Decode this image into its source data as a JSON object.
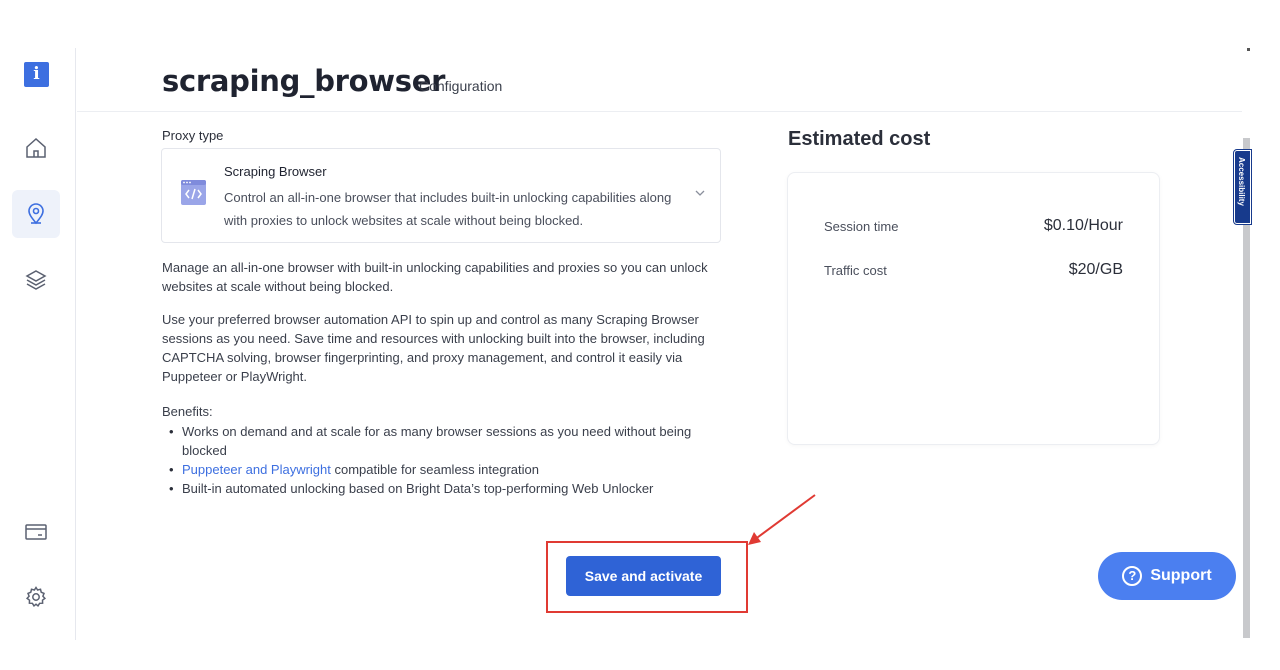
{
  "sidebar": {
    "logo": "i",
    "items": [
      {
        "icon": "home-icon"
      },
      {
        "icon": "location-pin-icon",
        "active": true
      },
      {
        "icon": "layers-icon"
      },
      {
        "icon": "billing-card-icon"
      },
      {
        "icon": "gear-icon"
      }
    ]
  },
  "header": {
    "title": "scraping_browser",
    "subtitle": "Configuration"
  },
  "proxy": {
    "label": "Proxy type",
    "name": "Scraping Browser",
    "description": "Control an all-in-one browser that includes built-in unlocking capabilities along with proxies to unlock websites at scale without being blocked."
  },
  "main": {
    "paragraph1": "Manage an all-in-one browser with built-in unlocking capabilities and proxies so you can unlock websites at scale without being blocked.",
    "paragraph2": "Use your preferred browser automation API to spin up and control as many Scraping Browser sessions as you need. Save time and resources with unlocking built into the browser, including CAPTCHA solving, browser fingerprinting, and proxy management, and control it easily via Puppeteer or PlayWright.",
    "benefits_label": "Benefits:",
    "benefits": [
      "Works on demand and at scale for as many browser sessions as you need without being blocked",
      "compatible for seamless integration",
      "Built-in automated unlocking based on Bright Data’s top-performing Web Unlocker"
    ],
    "benefit_link": "Puppeteer and Playwright"
  },
  "cost": {
    "title": "Estimated cost",
    "rows": [
      {
        "label": "Session time",
        "value": "$0.10/Hour"
      },
      {
        "label": "Traffic cost",
        "value": "$20/GB"
      }
    ]
  },
  "actions": {
    "save_label": "Save and activate"
  },
  "support": {
    "label": "Support",
    "icon": "question-icon"
  },
  "accessibility": {
    "label": "Accessibility"
  },
  "colors": {
    "primary": "#2f63d6",
    "support": "#4b7ff0",
    "annotation": "#e03a33"
  }
}
